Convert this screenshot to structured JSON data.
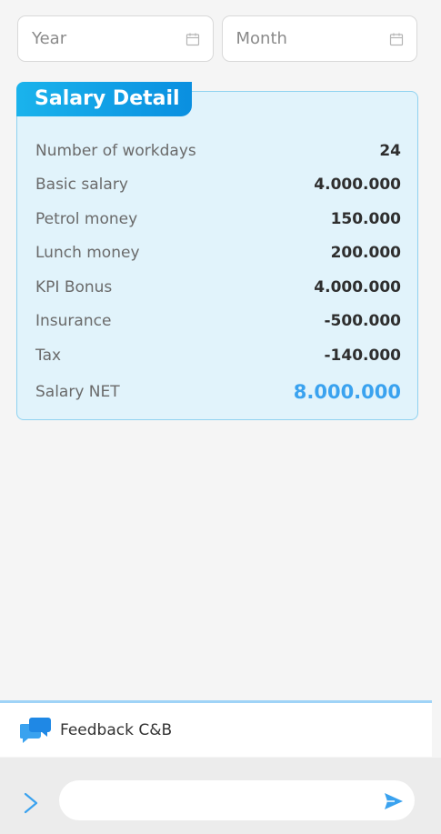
{
  "filters": {
    "year_placeholder": "Year",
    "month_placeholder": "Month"
  },
  "card": {
    "title": "Salary Detail",
    "rows": [
      {
        "label": "Number of workdays",
        "value": "24"
      },
      {
        "label": "Basic salary",
        "value": "4.000.000"
      },
      {
        "label": "Petrol money",
        "value": "150.000"
      },
      {
        "label": "Lunch money",
        "value": "200.000"
      },
      {
        "label": "KPI Bonus",
        "value": "4.000.000"
      },
      {
        "label": "Insurance",
        "value": "-500.000"
      },
      {
        "label": "Tax",
        "value": "-140.000"
      }
    ],
    "net": {
      "label": "Salary NET",
      "value": "8.000.000"
    }
  },
  "feedback": {
    "label": "Feedback C&B"
  },
  "input": {
    "placeholder": ""
  },
  "colors": {
    "accent": "#3aa2ef",
    "card_bg": "#e1f3fb",
    "card_border": "#8fd2f0"
  },
  "icons": [
    "calendar-icon",
    "chat-bubbles-icon",
    "chevron-right-icon",
    "send-icon"
  ]
}
